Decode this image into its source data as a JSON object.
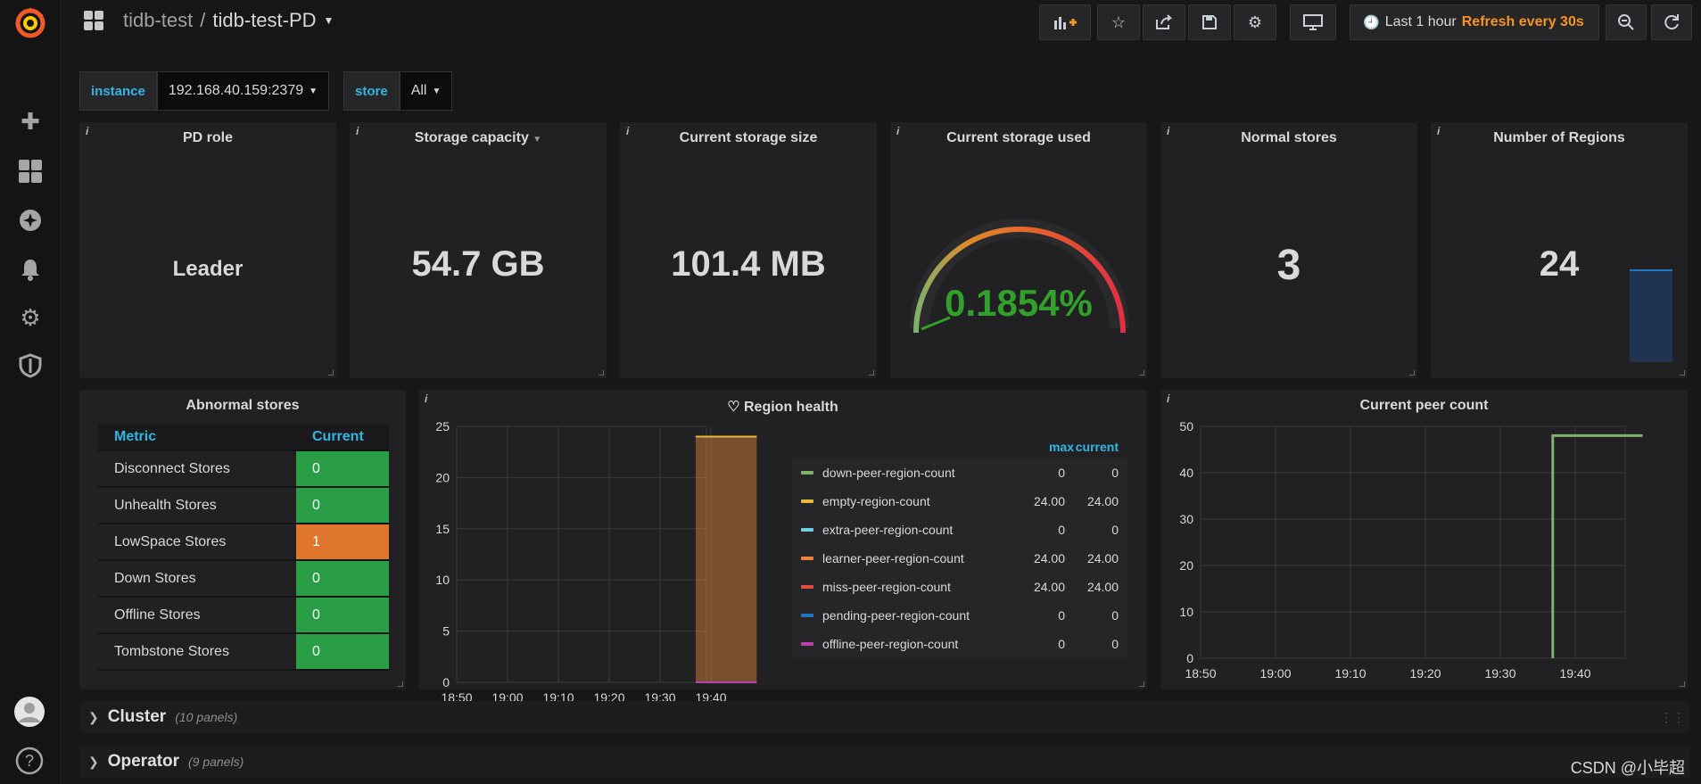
{
  "breadcrumb": {
    "folder": "tidb-test",
    "separator": "/",
    "dashboard": "tidb-test-PD"
  },
  "timepicker": {
    "range": "Last 1 hour",
    "refresh": "Refresh every 30s"
  },
  "variables": [
    {
      "label": "instance",
      "value": "192.168.40.159:2379"
    },
    {
      "label": "store",
      "value": "All"
    }
  ],
  "stats": {
    "pd_role": {
      "title": "PD role",
      "value": "Leader"
    },
    "storage_capacity": {
      "title": "Storage capacity",
      "value": "54.7 GB"
    },
    "current_storage_size": {
      "title": "Current storage size",
      "value": "101.4 MB"
    },
    "current_storage_used": {
      "title": "Current storage used",
      "value": "0.1854%"
    },
    "normal_stores": {
      "title": "Normal stores",
      "value": "3"
    },
    "number_of_regions": {
      "title": "Number of Regions",
      "value": "24"
    }
  },
  "abnormal_stores": {
    "title": "Abnormal stores",
    "headers": [
      "Metric",
      "Current"
    ],
    "rows": [
      {
        "metric": "Disconnect Stores",
        "current": "0",
        "status": "ok"
      },
      {
        "metric": "Unhealth Stores",
        "current": "0",
        "status": "ok"
      },
      {
        "metric": "LowSpace Stores",
        "current": "1",
        "status": "warn"
      },
      {
        "metric": "Down Stores",
        "current": "0",
        "status": "ok"
      },
      {
        "metric": "Offline Stores",
        "current": "0",
        "status": "ok"
      },
      {
        "metric": "Tombstone Stores",
        "current": "0",
        "status": "ok"
      }
    ]
  },
  "region_health": {
    "title": "Region health",
    "legend_headers": [
      "max",
      "current"
    ],
    "legend": [
      {
        "name": "down-peer-region-count",
        "max": "0",
        "current": "0",
        "color": "#7eb26d"
      },
      {
        "name": "empty-region-count",
        "max": "24.00",
        "current": "24.00",
        "color": "#eab839"
      },
      {
        "name": "extra-peer-region-count",
        "max": "0",
        "current": "0",
        "color": "#6ed0e0"
      },
      {
        "name": "learner-peer-region-count",
        "max": "24.00",
        "current": "24.00",
        "color": "#ef843c"
      },
      {
        "name": "miss-peer-region-count",
        "max": "24.00",
        "current": "24.00",
        "color": "#e24d42"
      },
      {
        "name": "pending-peer-region-count",
        "max": "0",
        "current": "0",
        "color": "#1f78c1"
      },
      {
        "name": "offline-peer-region-count",
        "max": "0",
        "current": "0",
        "color": "#ba43a9"
      }
    ]
  },
  "current_peer_count": {
    "title": "Current peer count"
  },
  "chart_data": [
    {
      "type": "area",
      "title": "Region health",
      "x": [
        "18:50",
        "19:00",
        "19:10",
        "19:20",
        "19:30",
        "19:40"
      ],
      "ylim": [
        0,
        25
      ],
      "yticks": [
        0,
        5,
        10,
        15,
        20,
        25
      ],
      "series": [
        {
          "name": "miss-peer-region-count",
          "segment": {
            "from": "19:37",
            "to": "19:49",
            "value": 24
          }
        },
        {
          "name": "learner-peer-region-count",
          "segment": {
            "from": "19:37",
            "to": "19:49",
            "value": 24
          }
        },
        {
          "name": "empty-region-count",
          "segment": {
            "from": "19:37",
            "to": "19:49",
            "value": 24
          }
        },
        {
          "name": "offline-peer-region-count",
          "segment": {
            "from": "19:37",
            "to": "19:49",
            "value": 0
          }
        }
      ]
    },
    {
      "type": "line",
      "title": "Current peer count",
      "x": [
        "18:50",
        "19:00",
        "19:10",
        "19:20",
        "19:30",
        "19:40"
      ],
      "ylim": [
        0,
        50
      ],
      "yticks": [
        0,
        10,
        20,
        30,
        40,
        50
      ],
      "series": [
        {
          "steps": [
            {
              "t": "19:37",
              "value": 0
            },
            {
              "t": "19:37",
              "value": 48
            },
            {
              "t": "19:49",
              "value": 48
            }
          ]
        }
      ]
    }
  ],
  "rows": [
    {
      "title": "Cluster",
      "sub": "(10 panels)"
    },
    {
      "title": "Operator",
      "sub": "(9 panels)"
    }
  ],
  "watermark": "CSDN @小毕超"
}
